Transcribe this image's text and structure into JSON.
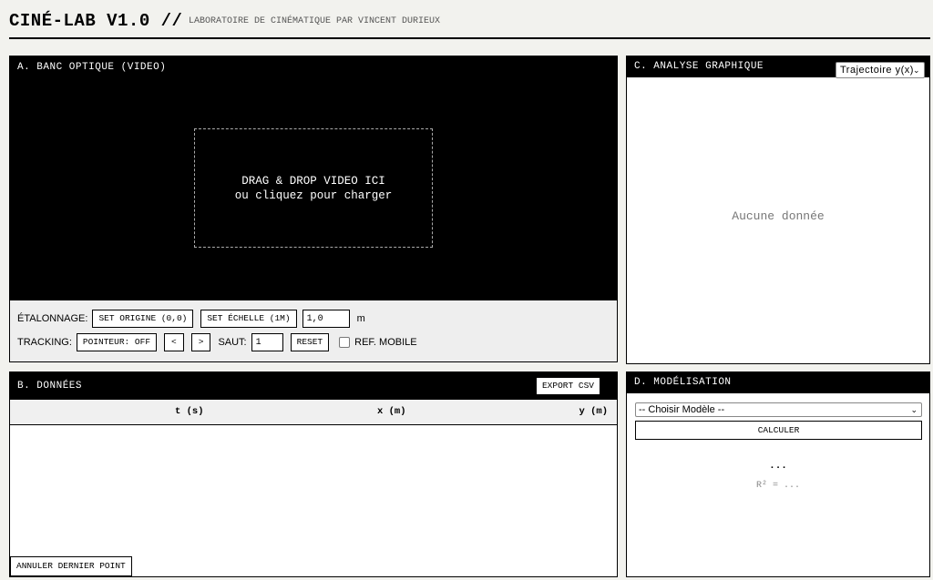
{
  "header": {
    "title": "CINÉ-LAB V1.0 //",
    "subtitle": "LABORATOIRE DE CINÉMATIQUE PAR VINCENT DURIEUX"
  },
  "panel_a": {
    "title": "A. BANC OPTIQUE (VIDEO)",
    "drop_line1": "DRAG & DROP VIDEO ICI",
    "drop_line2": "ou cliquez pour charger",
    "calibration_label": "ÉTALONNAGE:",
    "set_origin": "SET ORIGINE (0,0)",
    "set_scale": "SET ÉCHELLE (1M)",
    "scale_value": "1,0",
    "scale_unit": "m",
    "tracking_label": "TRACKING:",
    "pointer": "POINTEUR: OFF",
    "prev": "<",
    "next": ">",
    "step_label": "SAUT:",
    "step_value": "1",
    "reset": "RESET",
    "ref_mobile": "REF. MOBILE"
  },
  "panel_b": {
    "title": "B. DONNÉES",
    "export": "EXPORT CSV",
    "columns": [
      "t (s)",
      "x (m)",
      "y (m)"
    ],
    "rows": [],
    "undo": "ANNULER DERNIER POINT"
  },
  "panel_c": {
    "title": "C. ANALYSE GRAPHIQUE",
    "view_selected": "Trajectoire y(x)",
    "empty": "Aucune donnée"
  },
  "panel_d": {
    "title": "D. MODÉLISATION",
    "model_selected": "-- Choisir Modèle --",
    "calculate": "CALCULER",
    "equation": "...",
    "r2": "R² = ..."
  },
  "colors": {
    "background": "#f2f2ee",
    "panel_header": "#000000",
    "video_bg": "#000000"
  },
  "icons": [
    "chevron-down-icon",
    "checkbox-icon"
  ]
}
